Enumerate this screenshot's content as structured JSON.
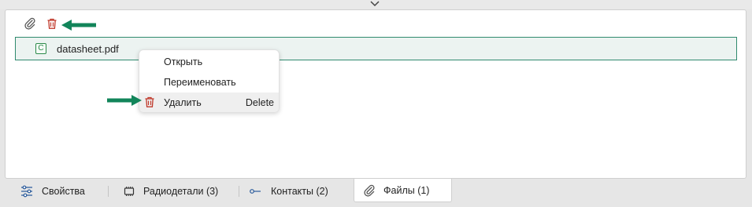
{
  "colors": {
    "accent": "#2f8a6e",
    "delete_red": "#c0392b",
    "arrow_green": "#12855a",
    "icon_blue": "#2a5b9c"
  },
  "toolbar": {
    "attach_icon": "paperclip-icon",
    "delete_icon": "trash-icon"
  },
  "file_list": {
    "items": [
      {
        "badge": "C",
        "name": "datasheet.pdf"
      }
    ]
  },
  "context_menu": {
    "items": [
      {
        "label": "Открыть",
        "shortcut": ""
      },
      {
        "label": "Переименовать",
        "shortcut": ""
      },
      {
        "label": "Удалить",
        "shortcut": "Delete",
        "icon": "trash-icon"
      }
    ]
  },
  "tabs": [
    {
      "label": "Свойства",
      "icon": "sliders-icon"
    },
    {
      "label": "Радиодетали (3)",
      "icon": "chip-icon"
    },
    {
      "label": "Контакты (2)",
      "icon": "pin-icon"
    },
    {
      "label": "Файлы (1)",
      "icon": "paperclip-icon",
      "active": true
    }
  ]
}
